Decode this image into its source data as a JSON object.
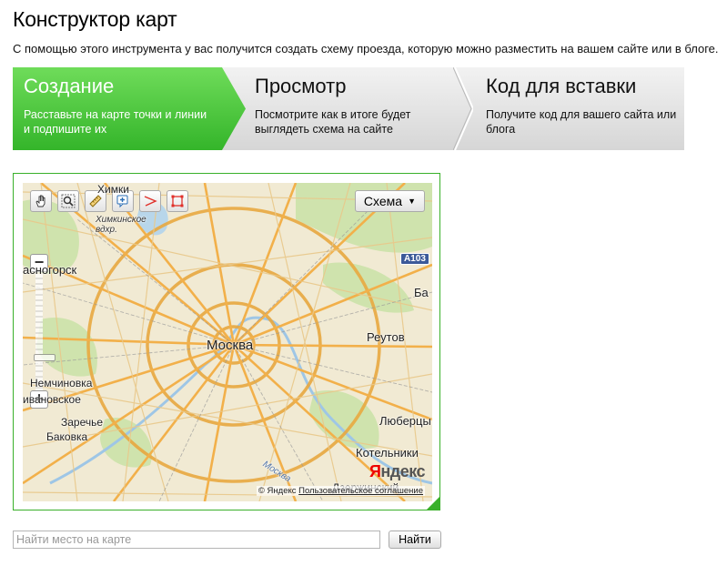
{
  "page": {
    "title": "Конструктор карт",
    "subtitle": "С помощью этого инструмента у вас получится создать схему проезда, которую можно разместить на вашем сайте или в блоге."
  },
  "steps": [
    {
      "title": "Создание",
      "desc": "Расставьте на карте точки и линии и подпишите их",
      "active": true
    },
    {
      "title": "Просмотр",
      "desc": "Посмотрите как в итоге будет выглядеть схема на сайте",
      "active": false
    },
    {
      "title": "Код для вставки",
      "desc": "Получите код для вашего сайта или блога",
      "active": false
    }
  ],
  "colors": {
    "accent": "#39b029",
    "active_step_top": "#6fdc5a",
    "active_step_bottom": "#34b52a",
    "road_major": "#f2b04a",
    "map_bg": "#f1ead3",
    "park": "#cfe3ad"
  },
  "map": {
    "tools": [
      "hand-icon",
      "magnifier-icon",
      "ruler-icon",
      "add-placemark-icon",
      "polyline-icon",
      "polygon-icon"
    ],
    "layer_label": "Схема",
    "zoom_in": "+",
    "zoom_out": "−",
    "labels": {
      "khimki": "Химки",
      "khimki_reservoir": "Химкинское вдхр.",
      "krasnogorsk": "асногорск",
      "moskva": "Москва",
      "reutov": "Реутов",
      "ba": "Ба",
      "nemchinovka": "Немчиновка",
      "ivanovskoe": "ивановское",
      "zarechye": "Заречье",
      "bakovka": "Баковка",
      "lyubertsy": "Люберцы",
      "kotelniki": "Котельники",
      "dzerzhinsky": "Дзержинский",
      "river": "Москва",
      "highway": "A103"
    },
    "logo": {
      "y": "Я",
      "rest": "ндекс"
    },
    "copyright": {
      "owner": "© Яндекс",
      "link": "Пользовательское соглашение"
    }
  },
  "search": {
    "placeholder": "Найти место на карте",
    "button": "Найти"
  }
}
